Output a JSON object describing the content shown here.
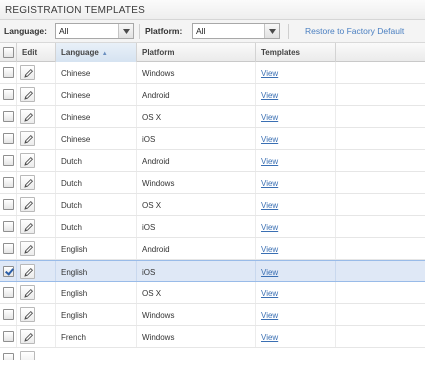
{
  "panel": {
    "title": "REGISTRATION TEMPLATES"
  },
  "filters": {
    "language_label": "Language:",
    "language_value": "All",
    "platform_label": "Platform:",
    "platform_value": "All",
    "restore_label": "Restore to Factory Default"
  },
  "columns": {
    "edit": "Edit",
    "language": "Language",
    "platform": "Platform",
    "templates": "Templates"
  },
  "rows": [
    {
      "language": "Chinese",
      "platform": "Windows",
      "link": "View",
      "checked": false
    },
    {
      "language": "Chinese",
      "platform": "Android",
      "link": "View",
      "checked": false
    },
    {
      "language": "Chinese",
      "platform": "OS X",
      "link": "View",
      "checked": false
    },
    {
      "language": "Chinese",
      "platform": "iOS",
      "link": "View",
      "checked": false
    },
    {
      "language": "Dutch",
      "platform": "Android",
      "link": "View",
      "checked": false
    },
    {
      "language": "Dutch",
      "platform": "Windows",
      "link": "View",
      "checked": false
    },
    {
      "language": "Dutch",
      "platform": "OS X",
      "link": "View",
      "checked": false
    },
    {
      "language": "Dutch",
      "platform": "iOS",
      "link": "View",
      "checked": false
    },
    {
      "language": "English",
      "platform": "Android",
      "link": "View",
      "checked": false
    },
    {
      "language": "English",
      "platform": "iOS",
      "link": "View",
      "checked": true
    },
    {
      "language": "English",
      "platform": "OS X",
      "link": "View",
      "checked": false
    },
    {
      "language": "English",
      "platform": "Windows",
      "link": "View",
      "checked": false
    },
    {
      "language": "French",
      "platform": "Windows",
      "link": "View",
      "checked": false
    }
  ],
  "colors": {
    "selected_row": "#dfe8f6",
    "link": "#3a6fb3",
    "restore_link": "#4a7fc1"
  }
}
